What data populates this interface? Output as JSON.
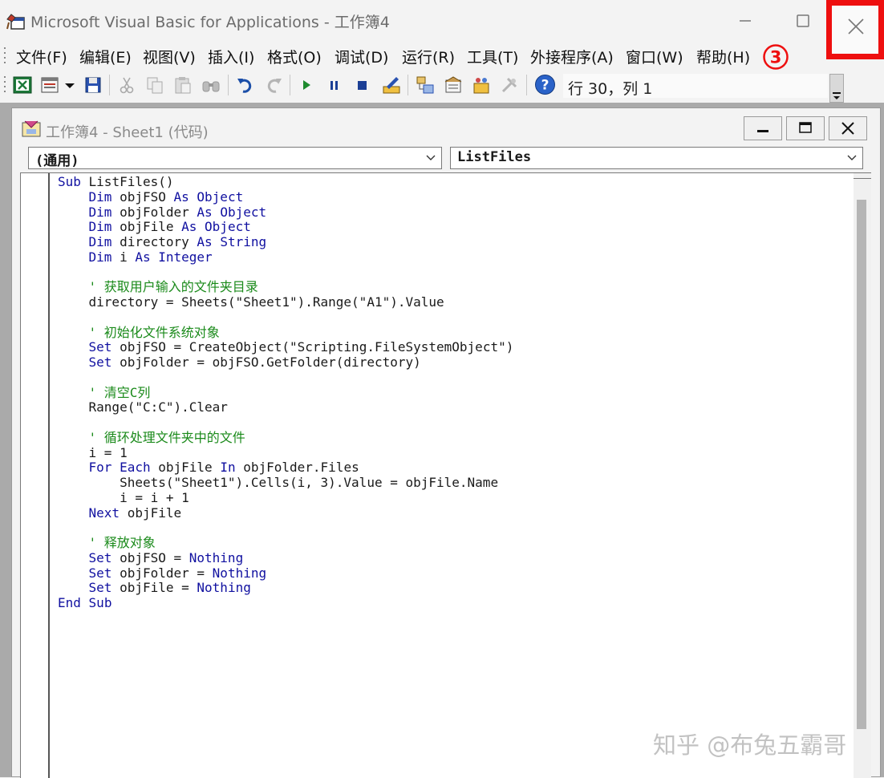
{
  "app": {
    "title": "Microsoft Visual Basic for Applications - 工作簿4"
  },
  "menu": {
    "items": [
      "文件(F)",
      "编辑(E)",
      "视图(V)",
      "插入(I)",
      "格式(O)",
      "调试(D)",
      "运行(R)",
      "工具(T)",
      "外接程序(A)",
      "窗口(W)",
      "帮助(H)"
    ],
    "step_marker": "③"
  },
  "toolbar": {
    "icons": [
      "excel-icon",
      "insert-module-icon",
      "dropdown-arrow-icon",
      "save-icon",
      "cut-icon",
      "copy-icon",
      "paste-icon",
      "find-icon",
      "undo-icon",
      "redo-icon",
      "run-icon",
      "break-icon",
      "reset-icon",
      "design-mode-icon",
      "project-explorer-icon",
      "properties-icon",
      "object-browser-icon",
      "toolbox-icon",
      "help-icon"
    ],
    "cursor_position": "行 30，列 1"
  },
  "code_window": {
    "title": "工作簿4 - Sheet1 (代码)",
    "object_selector": "(通用)",
    "procedure_selector": "ListFiles"
  },
  "code_lines": [
    "Sub ListFiles()",
    "    Dim objFSO As Object",
    "    Dim objFolder As Object",
    "    Dim objFile As Object",
    "    Dim directory As String",
    "    Dim i As Integer",
    "",
    "    ' 获取用户输入的文件夹目录",
    "    directory = Sheets(\"Sheet1\").Range(\"A1\").Value",
    "",
    "    ' 初始化文件系统对象",
    "    Set objFSO = CreateObject(\"Scripting.FileSystemObject\")",
    "    Set objFolder = objFSO.GetFolder(directory)",
    "",
    "    ' 清空C列",
    "    Range(\"C:C\").Clear",
    "",
    "    ' 循环处理文件夹中的文件",
    "    i = 1",
    "    For Each objFile In objFolder.Files",
    "        Sheets(\"Sheet1\").Cells(i, 3).Value = objFile.Name",
    "        i = i + 1",
    "    Next objFile",
    "",
    "    ' 释放对象",
    "    Set objFSO = Nothing",
    "    Set objFolder = Nothing",
    "    Set objFile = Nothing",
    "End Sub"
  ],
  "watermark": "知乎 @布兔五霸哥",
  "colors": {
    "keyword": "#1010a0",
    "comment": "#1a8a1a",
    "highlight_box": "#ee0f0f"
  }
}
